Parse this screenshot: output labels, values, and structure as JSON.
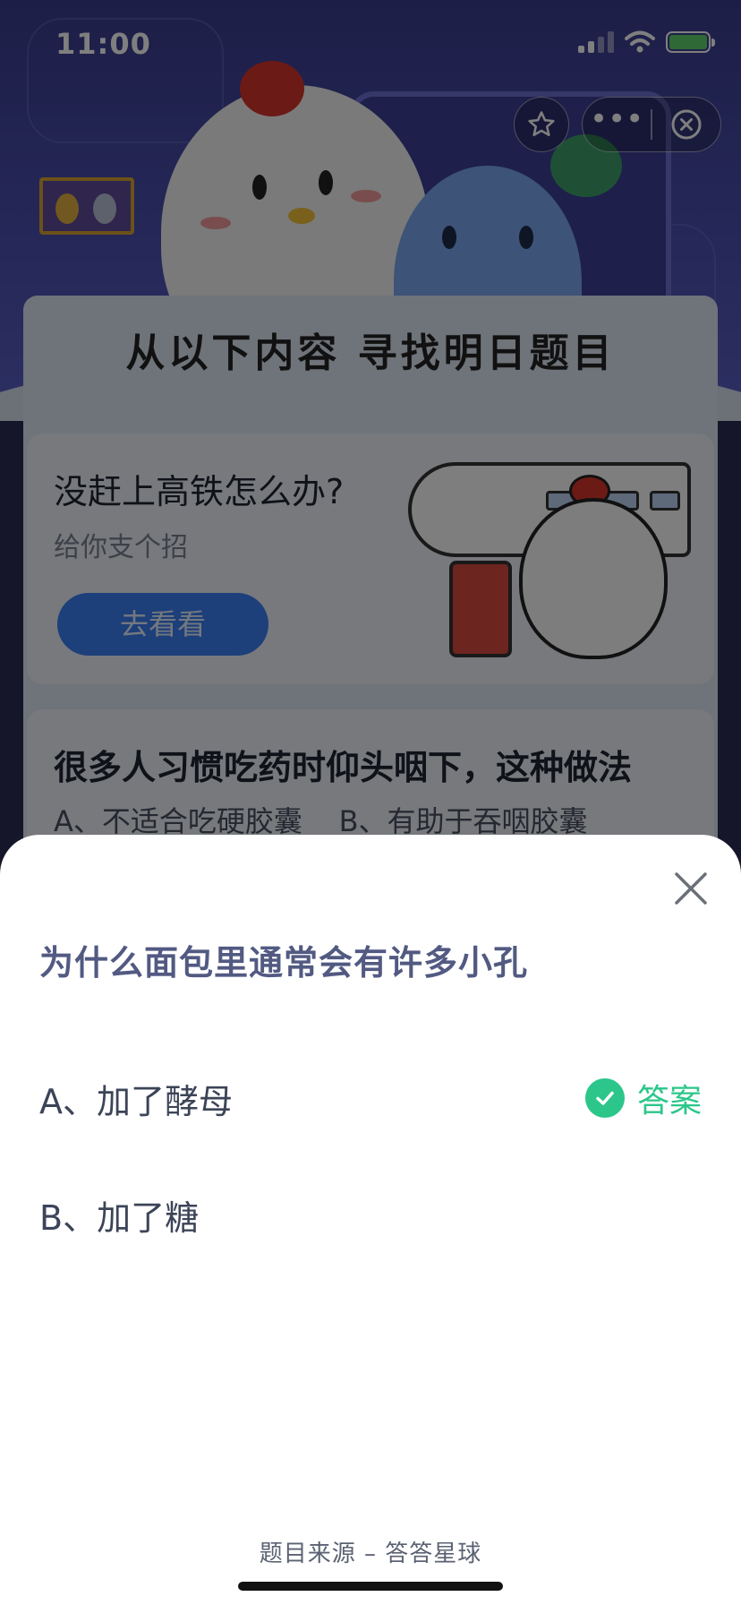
{
  "status_bar": {
    "time": "11:00",
    "icons": [
      "signal-icon",
      "wifi-icon",
      "battery-charging-icon"
    ]
  },
  "mini_program_capsule": {
    "favorite_icon": "star-icon",
    "more_label": "•••",
    "close_icon": "close-circle-icon"
  },
  "background_page": {
    "section_title": "从以下内容 寻找明日题目",
    "card1": {
      "title": "没赶上高铁怎么办?",
      "subtitle": "给你支个招",
      "button_label": "去看看"
    },
    "card2": {
      "title": "很多人习惯吃药时仰头咽下，这种做法",
      "options_line": "A、不适合吃硬胶囊    B、有助于吞咽胶囊"
    }
  },
  "sheet": {
    "question": "为什么面包里通常会有许多小孔",
    "options": [
      {
        "label": "A、加了酵母",
        "is_answer": true
      },
      {
        "label": "B、加了糖",
        "is_answer": false
      }
    ],
    "answer_label": "答案",
    "source": "题目来源 – 答答星球"
  },
  "colors": {
    "accent_green": "#2cc68a",
    "question_text": "#525a82",
    "sheet_background": "#ffffff",
    "overlay": "rgba(0,0,0,0.5)"
  }
}
